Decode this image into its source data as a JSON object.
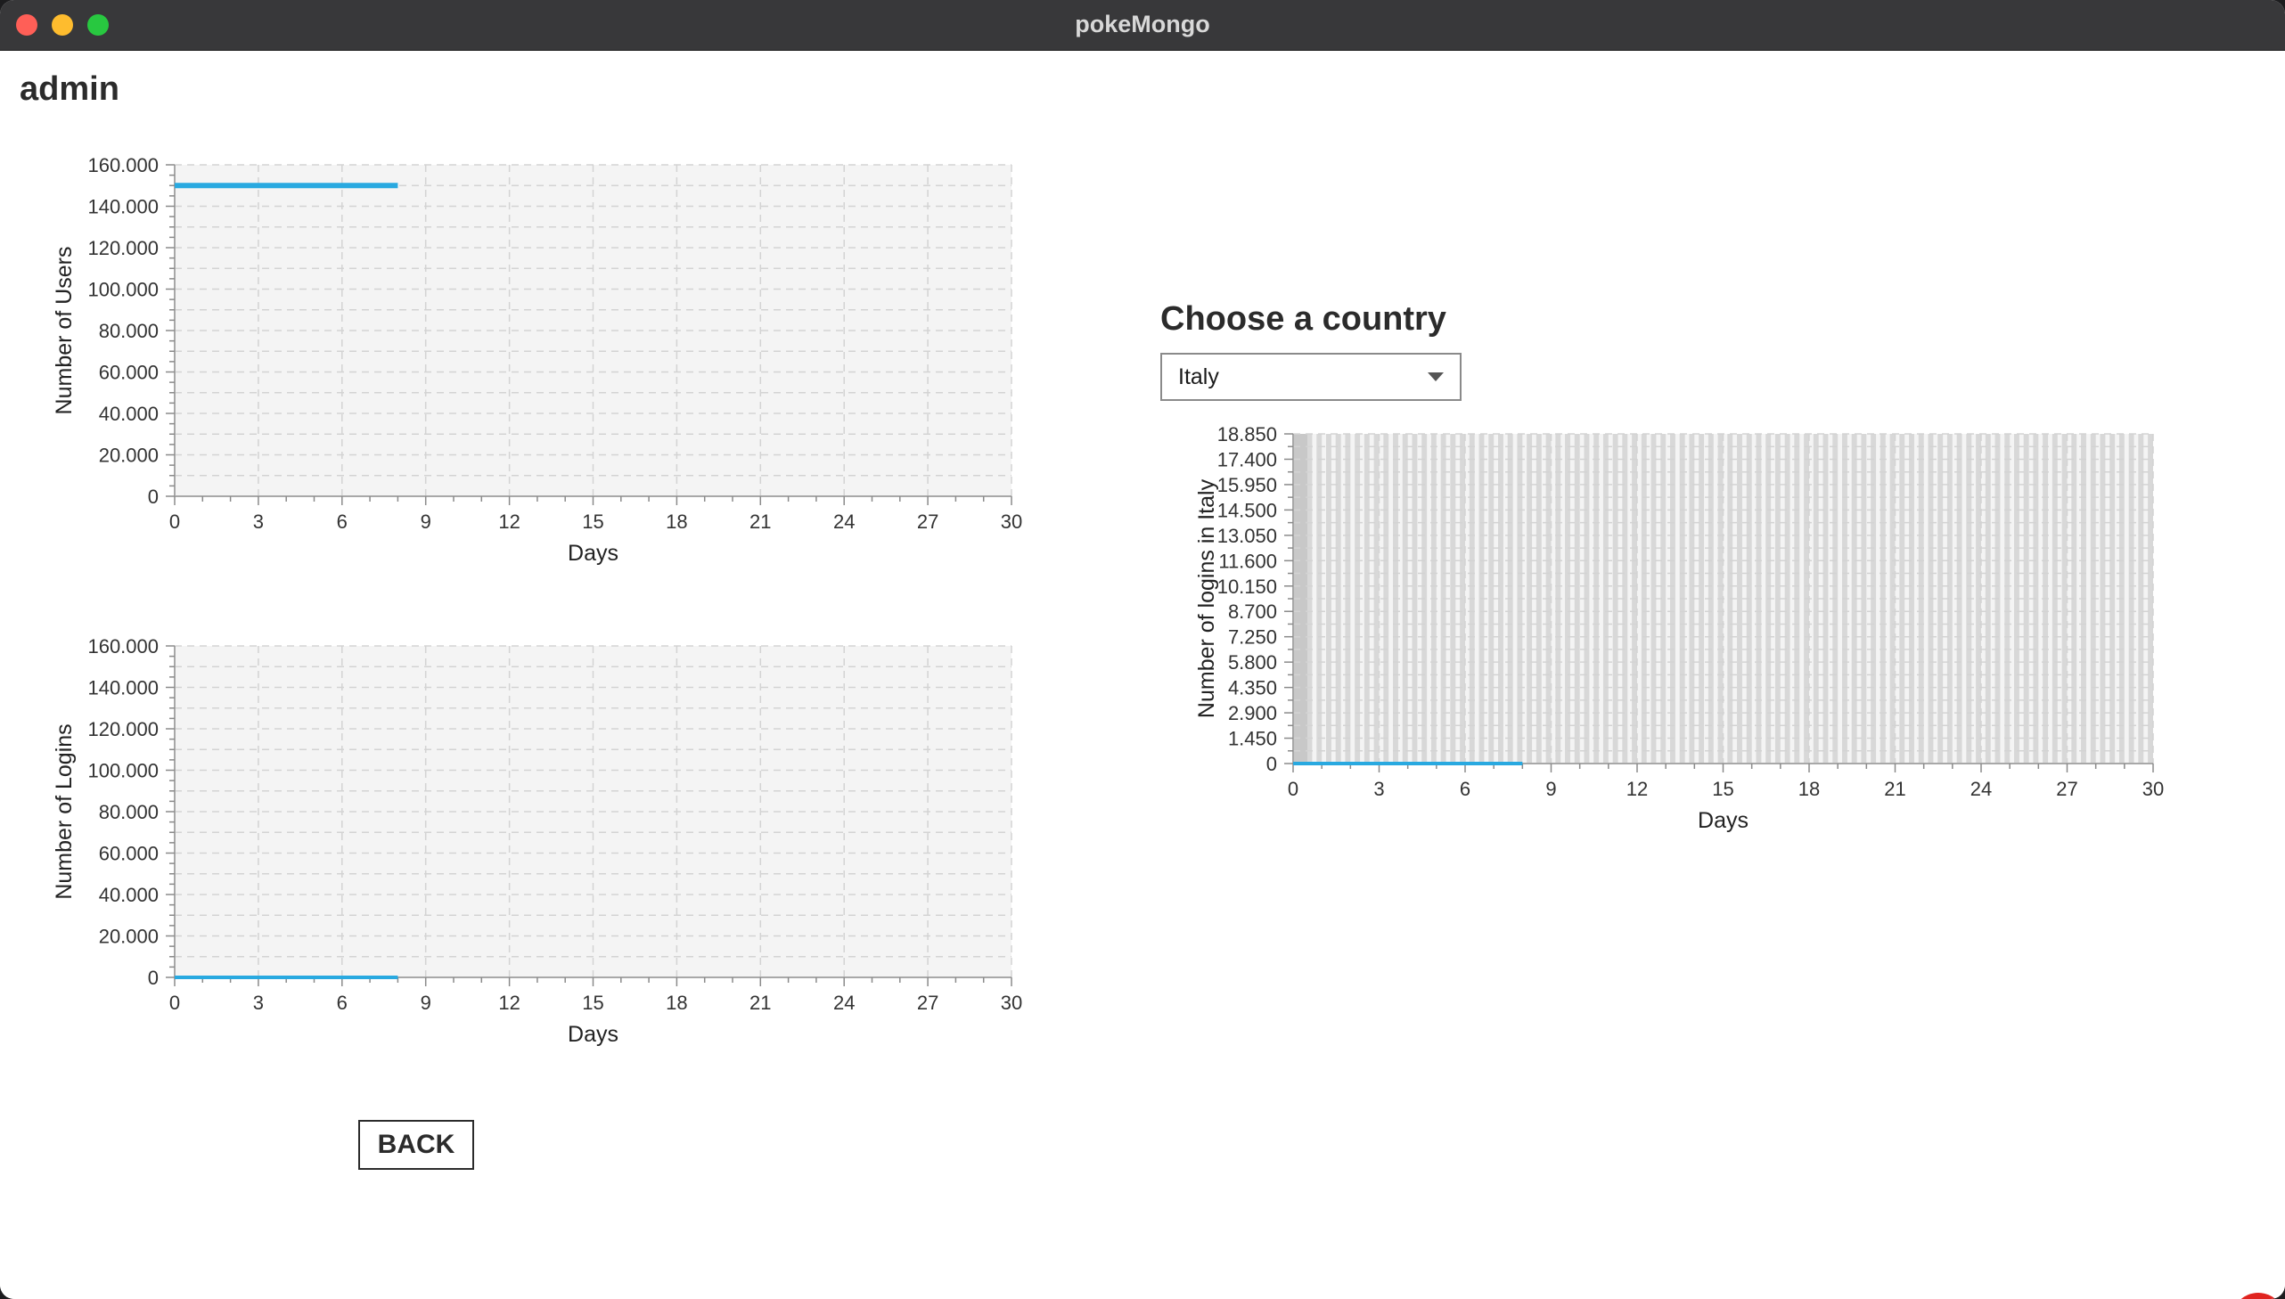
{
  "window": {
    "title": "pokeMongo"
  },
  "header": {
    "user": "admin"
  },
  "country_selector": {
    "label": "Choose a country",
    "selected": "Italy"
  },
  "back_button": {
    "label": "BACK"
  },
  "icons": {
    "sound": "speaker-icon",
    "dropdown": "chevron-down-icon"
  },
  "colors": {
    "series": "#29a9e0",
    "plot_bg": "#f4f4f4",
    "button_bg": "#e0241f"
  },
  "chart_data": [
    {
      "type": "line",
      "xlabel": "Days",
      "ylabel": "Number of Users",
      "xlim": [
        0,
        30
      ],
      "ylim": [
        0,
        160000
      ],
      "xticks": [
        "0",
        "3",
        "6",
        "9",
        "12",
        "15",
        "18",
        "21",
        "24",
        "27",
        "30"
      ],
      "yticks": [
        "0",
        "20.000",
        "40.000",
        "60.000",
        "80.000",
        "100.000",
        "120.000",
        "140.000",
        "160.000"
      ],
      "series": [
        {
          "x": [
            0,
            8
          ],
          "y": [
            150000,
            150000
          ]
        }
      ],
      "grid": true
    },
    {
      "type": "line",
      "xlabel": "Days",
      "ylabel": "Number of Logins",
      "xlim": [
        0,
        30
      ],
      "ylim": [
        0,
        160000
      ],
      "xticks": [
        "0",
        "3",
        "6",
        "9",
        "12",
        "15",
        "18",
        "21",
        "24",
        "27",
        "30"
      ],
      "yticks": [
        "0",
        "20.000",
        "40.000",
        "60.000",
        "80.000",
        "100.000",
        "120.000",
        "140.000",
        "160.000"
      ],
      "series": [
        {
          "x": [
            0,
            8
          ],
          "y": [
            0,
            0
          ]
        }
      ],
      "grid": true
    },
    {
      "type": "line",
      "xlabel": "Days",
      "ylabel": "Number of logins in Italy",
      "xlim": [
        0,
        30
      ],
      "ylim": [
        0,
        18850
      ],
      "xticks": [
        "0",
        "3",
        "6",
        "9",
        "12",
        "15",
        "18",
        "21",
        "24",
        "27",
        "30"
      ],
      "yticks": [
        "0",
        "1.450",
        "2.900",
        "4.350",
        "5.800",
        "7.250",
        "8.700",
        "10.150",
        "11.600",
        "13.050",
        "14.500",
        "15.950",
        "17.400",
        "18.850"
      ],
      "series": [
        {
          "x": [
            0,
            8
          ],
          "y": [
            0,
            0
          ]
        }
      ],
      "grid": true
    }
  ]
}
